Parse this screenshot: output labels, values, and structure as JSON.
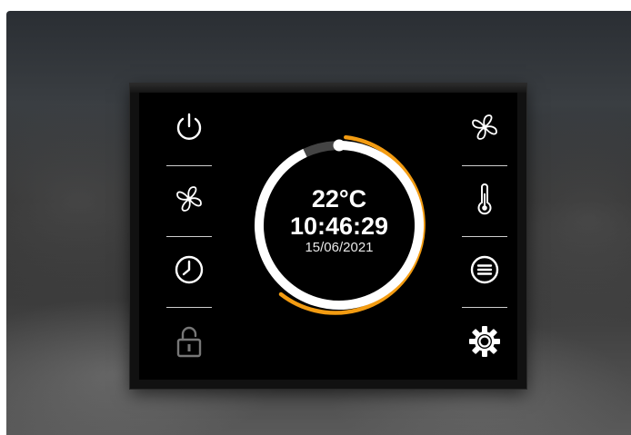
{
  "thermostat": {
    "temperature": "22°C",
    "time": "10:46:29",
    "date": "15/06/2021",
    "setpoint_fraction": 0.4
  },
  "left_buttons": [
    {
      "icon": "power-icon"
    },
    {
      "icon": "fan-icon"
    },
    {
      "icon": "clock-icon"
    },
    {
      "icon": "lock-icon",
      "state": "disabled"
    }
  ],
  "right_buttons": [
    {
      "icon": "fan-icon"
    },
    {
      "icon": "thermometer-icon"
    },
    {
      "icon": "menu-icon"
    },
    {
      "icon": "settings-icon"
    }
  ],
  "colors": {
    "accent": "#f39c12",
    "ring": "#ffffff",
    "ring_track": "#444444",
    "icon": "#ffffff",
    "icon_disabled": "#777777"
  }
}
